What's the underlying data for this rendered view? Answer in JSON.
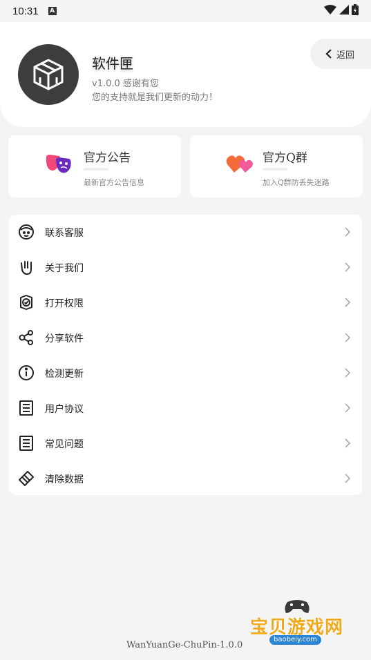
{
  "status_bar": {
    "time": "10:31",
    "notif_icon": "A"
  },
  "header": {
    "app_name": "软件匣",
    "version_line": "v1.0.0 感谢有您",
    "thanks_line": "您的支持就是我们更新的动力！",
    "back_label": "返回",
    "avatar_bg": "#3d3d3d"
  },
  "cards": [
    {
      "title": "官方公告",
      "subtitle": "最新官方公告信息",
      "icon": "masks-icon"
    },
    {
      "title": "官方Q群",
      "subtitle": "加入Q群防丢失迷路",
      "icon": "hearts-icon"
    }
  ],
  "menu": [
    {
      "label": "联系客服",
      "icon": "face-icon"
    },
    {
      "label": "关于我们",
      "icon": "hand-icon"
    },
    {
      "label": "打开权限",
      "icon": "shield-check-icon"
    },
    {
      "label": "分享软件",
      "icon": "share-icon"
    },
    {
      "label": "检测更新",
      "icon": "info-icon"
    },
    {
      "label": "用户协议",
      "icon": "document-icon"
    },
    {
      "label": "常见问题",
      "icon": "document-icon"
    },
    {
      "label": "清除数据",
      "icon": "eraser-icon"
    }
  ],
  "footer": {
    "version_text": "WanYuanGe-ChuPin-1.0.0"
  },
  "watermark": {
    "text": "宝贝游戏网",
    "url": "baobeiy.com"
  }
}
